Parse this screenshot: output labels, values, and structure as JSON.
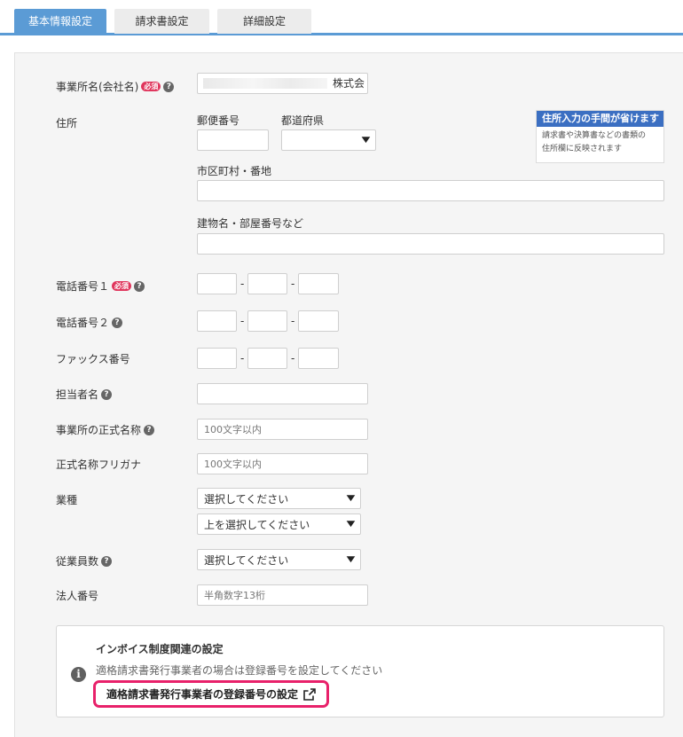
{
  "tabs": [
    {
      "label": "基本情報設定"
    },
    {
      "label": "請求書設定"
    },
    {
      "label": "詳細設定"
    }
  ],
  "form": {
    "company": {
      "label": "事業所名(会社名)",
      "required_badge": "必須",
      "value_suffix": "株式会"
    },
    "address": {
      "label": "住所",
      "postal_label": "郵便番号",
      "prefecture_label": "都道府県",
      "city_label": "市区町村・番地",
      "building_label": "建物名・部屋番号など",
      "tip_title": "住所入力の手間が省けます",
      "tip_body_line1": "請求書や決算書などの書類の",
      "tip_body_line2": "住所欄に反映されます"
    },
    "phone1": {
      "label": "電話番号１",
      "required_badge": "必須",
      "sep": "-"
    },
    "phone2": {
      "label": "電話番号２",
      "sep": "-"
    },
    "fax": {
      "label": "ファックス番号",
      "sep": "-"
    },
    "contact": {
      "label": "担当者名"
    },
    "official_name": {
      "label": "事業所の正式名称",
      "placeholder": "100文字以内"
    },
    "official_kana": {
      "label": "正式名称フリガナ",
      "placeholder": "100文字以内"
    },
    "industry": {
      "label": "業種",
      "select1": "選択してください",
      "select2": "上を選択してください"
    },
    "employees": {
      "label": "従業員数",
      "select": "選択してください"
    },
    "corp_number": {
      "label": "法人番号",
      "placeholder": "半角数字13桁"
    }
  },
  "invoice": {
    "title": "インボイス制度関連の設定",
    "description": "適格請求書発行事業者の場合は登録番号を設定してください",
    "link_label": "適格請求書発行事業者の登録番号の設定"
  },
  "icons": {
    "help": "question-circle-icon",
    "info": "info-circle-icon",
    "external": "external-link-icon",
    "dropdown": "chevron-down-icon"
  },
  "colors": {
    "accent": "#5b9bd5",
    "required": "#e0365d",
    "tip_header": "#3b6fc2",
    "highlight": "#e8216a"
  }
}
